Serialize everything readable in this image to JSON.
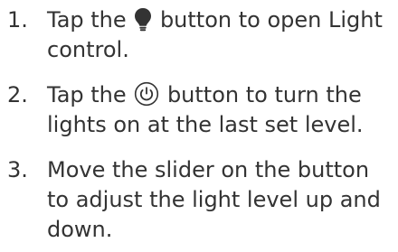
{
  "steps": [
    {
      "number": "1.",
      "line1_before": "Tap the",
      "icon": "lightbulb-icon",
      "line1_after": "button to open Light",
      "line2": "control."
    },
    {
      "number": "2.",
      "line1_before": "Tap the",
      "icon": "power-icon",
      "line1_after": "button to turn the",
      "line2": "lights on at the last set level."
    },
    {
      "number": "3.",
      "line1": "Move the slider on the button",
      "line2": "to adjust the light level up and",
      "line3": "down."
    }
  ],
  "colors": {
    "text": "#333333",
    "icon": "#333333",
    "background": "#ffffff"
  }
}
